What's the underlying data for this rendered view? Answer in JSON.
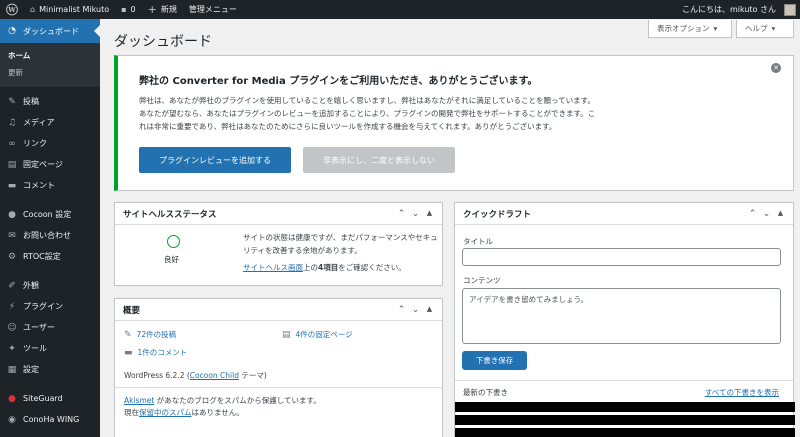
{
  "adminbar": {
    "site_name": "Minimalist Mikuto",
    "comments_count": "0",
    "new_label": "新規",
    "manage_menu": "管理メニュー",
    "greeting": "こんにちは、mikuto さん"
  },
  "sidebar": {
    "dashboard": "ダッシュボード",
    "sub_home": "ホーム",
    "sub_update": "更新",
    "posts": "投稿",
    "media": "メディア",
    "links": "リンク",
    "pages": "固定ページ",
    "comments": "コメント",
    "cocoon": "Cocoon 設定",
    "contact": "お問い合わせ",
    "rtoc": "RTOC設定",
    "appearance": "外観",
    "plugins": "プラグイン",
    "users": "ユーザー",
    "tools": "ツール",
    "settings": "設定",
    "siteguard": "SiteGuard",
    "conoha": "ConoHa WING"
  },
  "header": {
    "title": "ダッシュボード",
    "screen_options": "表示オプション",
    "help": "ヘルプ"
  },
  "notice": {
    "title": "弊社の Converter for Media プラグインをご利用いただき、ありがとうございます。",
    "line1": "弊社は、あなたが弊社のプラグインを使用していることを嬉しく思いますし、弊社はあなたがそれに満足していることを願っています。",
    "line2": "あなたが望むなら、あなたはプラグインのレビューを追加することにより、プラグインの開発で弊社をサポートすることができます。こ",
    "line3": "れは非常に重要であり、弊社はあなたのためにさらに良いツールを作成する機会を与えてくれます。ありがとうございます。",
    "primary_button": "プラグインレビューを追加する",
    "secondary_button": "非表示にし、二度と表示しない"
  },
  "site_health": {
    "title": "サイトヘルスステータス",
    "status": "良好",
    "text": "サイトの状態は健康ですが、まだパフォーマンスやセキュリティを改善する余地があります。",
    "link_text": "サイトヘルス画面",
    "link_suffix_pre": "上の",
    "link_suffix_bold": "4項目",
    "link_suffix_post": "をご確認ください。"
  },
  "overview": {
    "title": "概要",
    "posts": "72件の投稿",
    "pages": "4件の固定ページ",
    "comments": "1件のコメント",
    "wp_version_pre": "WordPress 6.2.2 (",
    "theme_link": "Cocoon Child",
    "wp_version_post": " テーマ)",
    "akismet_link": "Akismet",
    "akismet_text": " があなたのブログをスパムから保護しています。",
    "spam_pre": "現在",
    "spam_link": "保留中のスパム",
    "spam_post": "はありません。"
  },
  "quick_draft": {
    "title": "クイックドラフト",
    "title_label": "タイトル",
    "content_label": "コンテンツ",
    "content_placeholder": "アイデアを書き留めてみましょう。",
    "save_button": "下書き保存",
    "recent_label": "最新の下書き",
    "all_drafts_link": "すべての下書きを表示"
  },
  "colors": {
    "adminbar": "#1d2327",
    "accent": "#2271b1",
    "notice_border": "#00a32a"
  }
}
